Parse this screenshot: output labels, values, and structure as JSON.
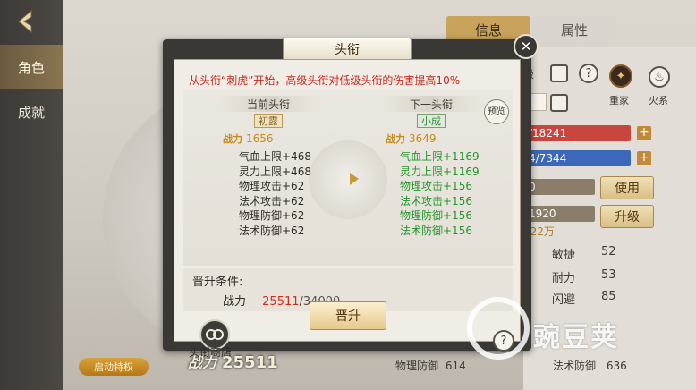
{
  "left_nav": {
    "back_icon": "back-arrow-icon",
    "tabs": [
      {
        "label": "角色",
        "active": true
      },
      {
        "label": "成就",
        "active": false
      }
    ]
  },
  "top_tabs": [
    {
      "label": "信息",
      "active": true
    },
    {
      "label": "属性",
      "active": false
    }
  ],
  "right_panel": {
    "partial_level_text": "级",
    "family_label": "重家",
    "faction_label": "火系",
    "hp_text": "/18241",
    "mp_text": "4/7344",
    "exp_value": "0",
    "exp2_value": "1920",
    "money_text": "922万",
    "use_label": "使用",
    "upgrade_label": "升级",
    "stats": [
      {
        "name": "敏捷",
        "value": "52"
      },
      {
        "name": "耐力",
        "value": "53"
      },
      {
        "name": "闪避",
        "value": "85"
      }
    ],
    "bar_colors": {
      "hp": "#c9463e",
      "mp": "#3b68b8"
    }
  },
  "modal": {
    "title": "头衔",
    "close": "✕",
    "notice": "从头衔“刺虎”开始，高级头衔对低级头衔的伤害提高10%",
    "current": {
      "header": "当前头衔",
      "title_name": "初露",
      "power": "1656",
      "attrs": [
        "气血上限+468",
        "灵力上限+468",
        "物理攻击+62",
        "法术攻击+62",
        "物理防御+62",
        "法术防御+62"
      ]
    },
    "next": {
      "header": "下一头衔",
      "title_name": "小成",
      "power": "3649",
      "attrs": [
        "气血上限+1169",
        "灵力上限+1169",
        "物理攻击+156",
        "法术攻击+156",
        "物理防御+156",
        "法术防御+156"
      ]
    },
    "power_prefix": "战力",
    "preview_label": "预览",
    "condition_title": "晋升条件:",
    "condition_label": "战力",
    "condition_current": "25511",
    "condition_required": "/34000",
    "upgrade_button": "晋升",
    "shop_label": "头衔商店",
    "help": "?"
  },
  "bottom": {
    "boost_label": "启动特权",
    "power_label": "战力",
    "power_value": "25511",
    "phys_def_label": "物理防御",
    "phys_def_value": "614",
    "magic_def_label": "法术防御",
    "magic_def_value": "636"
  },
  "watermark": "豌豆荚",
  "colors": {
    "accent_gold": "#c9a35c",
    "notice_red": "#c8271d",
    "next_green": "#23962a"
  }
}
